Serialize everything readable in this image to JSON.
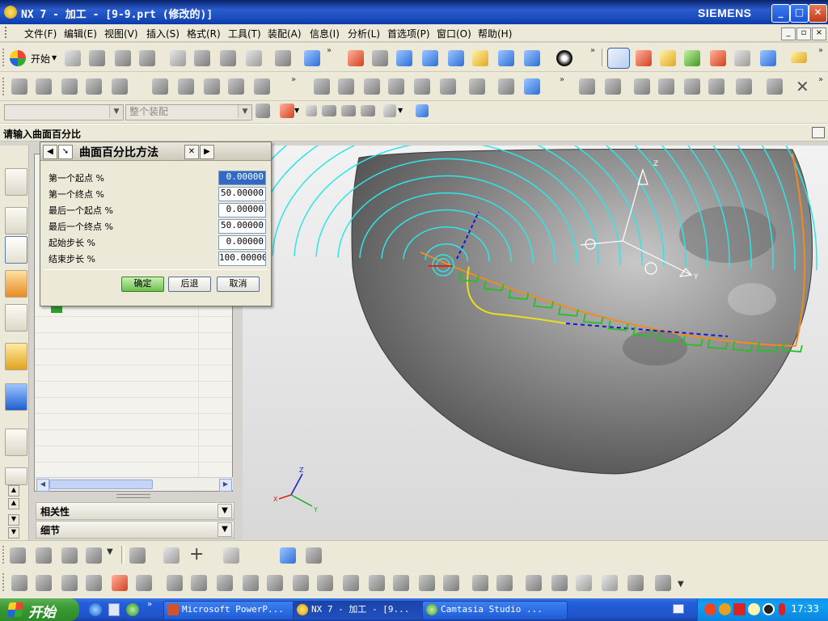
{
  "window": {
    "title": "NX 7 - 加工 - [9-9.prt (修改的)]",
    "brand": "SIEMENS",
    "buttons": [
      "_",
      "□",
      "✕"
    ]
  },
  "menubar": {
    "items": [
      "文件(F)",
      "编辑(E)",
      "视图(V)",
      "插入(S)",
      "格式(R)",
      "工具(T)",
      "装配(A)",
      "信息(I)",
      "分析(L)",
      "首选项(P)",
      "窗口(O)",
      "帮助(H)"
    ]
  },
  "toolbar": {
    "start_label": "开始"
  },
  "selection_bar": {
    "filter_value": "",
    "scope_value": "整个装配"
  },
  "cue_line": {
    "text": "请输入曲面百分比"
  },
  "dialog": {
    "title": "曲面百分比方法",
    "fields": [
      {
        "label": "第一个起点 %",
        "value": "0.00000"
      },
      {
        "label": "第一个终点 %",
        "value": "50.00000"
      },
      {
        "label": "最后一个起点 %",
        "value": "0.00000"
      },
      {
        "label": "最后一个终点 %",
        "value": "50.00000"
      },
      {
        "label": "起始步长 %",
        "value": "0.00000"
      },
      {
        "label": "结束步长 %",
        "value": "100.00000"
      }
    ],
    "ok_label": "确定",
    "back_label": "后退",
    "cancel_label": "取消"
  },
  "navigator": {
    "panels": [
      "相关性",
      "细节"
    ]
  },
  "graphics": {
    "colors": {
      "toolpath": "#2ee6e6",
      "boundary": "#f08c1e",
      "cut_region": "#22c21f",
      "drive": "#e8e01a",
      "blue_dash": "#1515d6",
      "body": "#7a7a7a"
    },
    "triad_labels": {
      "x": "X",
      "y": "Y",
      "z": "Z"
    }
  },
  "taskbar": {
    "start_label": "开始",
    "tasks": [
      {
        "label": "Microsoft PowerP..."
      },
      {
        "label": "NX 7 - 加工 - [9..."
      },
      {
        "label": "Camtasia Studio ..."
      }
    ],
    "clock": "17:33"
  }
}
